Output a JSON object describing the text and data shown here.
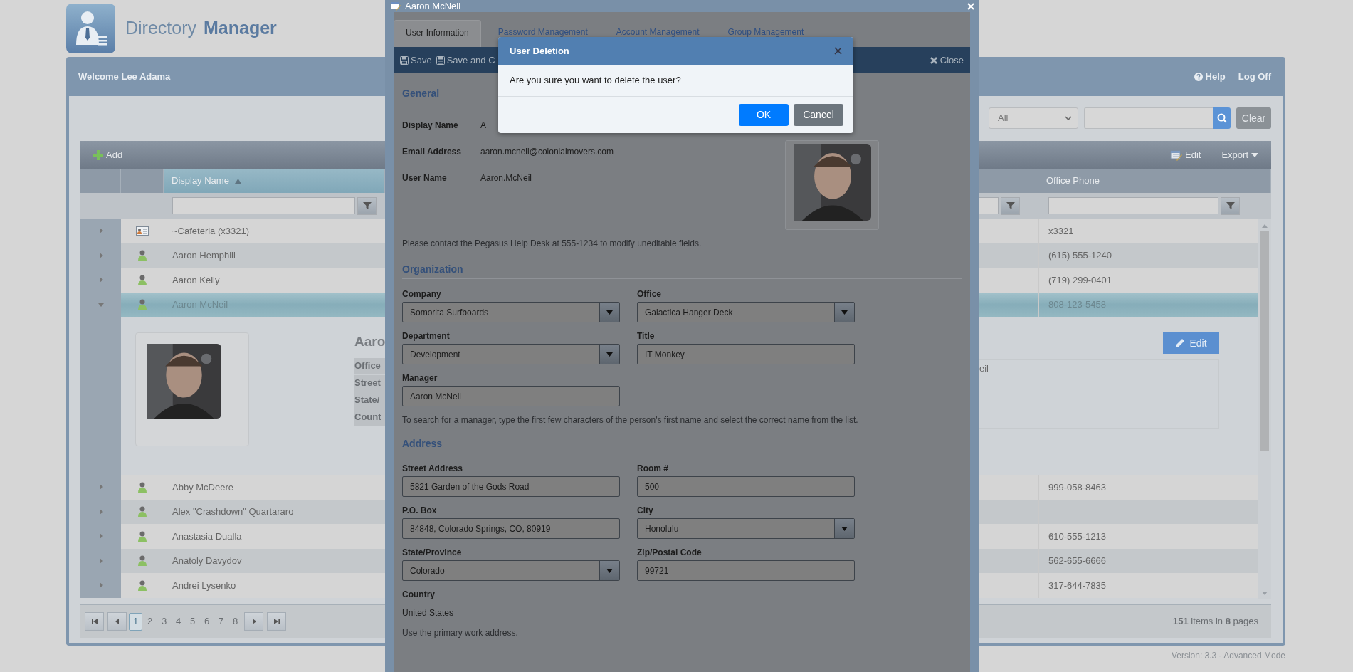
{
  "app": {
    "title_light": "Directory",
    "title_bold": "Manager",
    "welcome": "Welcome Lee Adama",
    "links": [
      {
        "label": "Help",
        "kind": "help"
      },
      {
        "label": "Log Off",
        "kind": "plain"
      }
    ],
    "version": "Version: 3.3 - Advanced Mode"
  },
  "search": {
    "scope": "All",
    "clear": "Clear"
  },
  "grid": {
    "toolbar": {
      "add": "Add",
      "edit": "Edit",
      "export": "Export"
    },
    "columns": [
      {
        "label": "Display Name",
        "sorted": true
      },
      {
        "label": "Office Phone",
        "sorted": false
      }
    ],
    "rows": [
      {
        "kind": "location",
        "name": "~Cafeteria (x3321)",
        "phone": "x3321",
        "expanded": false,
        "selected": false
      },
      {
        "kind": "person",
        "name": "Aaron Hemphill",
        "phone": "(615) 555-1240",
        "expanded": false,
        "selected": false
      },
      {
        "kind": "person",
        "name": "Aaron Kelly",
        "phone": "(719) 299-0401",
        "expanded": false,
        "selected": false
      },
      {
        "kind": "person",
        "name": "Aaron McNeil",
        "phone": "808-123-5458",
        "expanded": true,
        "selected": true
      },
      {
        "kind": "person",
        "name": "Abby McDeere",
        "phone": "999-058-8463",
        "expanded": false,
        "selected": false
      },
      {
        "kind": "person",
        "name": "Alex \"Crashdown\" Quartararo",
        "expanded": false,
        "selected": false
      },
      {
        "kind": "person",
        "name": "Anastasia Dualla",
        "phone": "610-555-1213",
        "expanded": false,
        "selected": false
      },
      {
        "kind": "person",
        "name": "Anatoly Davydov",
        "phone": "562-655-6666",
        "expanded": false,
        "selected": false
      },
      {
        "kind": "person",
        "name": "Andrei Lysenko",
        "phone": "317-644-7835",
        "expanded": false,
        "selected": false
      }
    ],
    "detail": {
      "heading": "Aaro",
      "labels": [
        "Office",
        "Street",
        "State/",
        "Count"
      ],
      "value_fragment": "eil",
      "edit": "Edit"
    },
    "pager": {
      "pages": [
        {
          "label": "1",
          "selected": true
        },
        {
          "label": "2",
          "selected": false
        },
        {
          "label": "3",
          "selected": false
        },
        {
          "label": "4",
          "selected": false
        },
        {
          "label": "5",
          "selected": false
        },
        {
          "label": "6",
          "selected": false
        },
        {
          "label": "7",
          "selected": false
        },
        {
          "label": "8",
          "selected": false
        }
      ],
      "summary": "**151** items in **8** pages"
    }
  },
  "edit_window": {
    "title": "Aaron McNeil",
    "tabs": [
      {
        "label": "User Information",
        "selected": true
      },
      {
        "label": "Password Management",
        "selected": false
      },
      {
        "label": "Account Management",
        "selected": false
      },
      {
        "label": "Group Management",
        "selected": false
      }
    ],
    "toolbar": {
      "save": "Save",
      "save_close": "Save and C",
      "close": "Close"
    },
    "general": {
      "heading": "General",
      "info": [
        {
          "label": "Display Name",
          "value": "A"
        },
        {
          "label": "Email Address",
          "value": "aaron.mcneil@colonialmovers.com"
        },
        {
          "label": "User Name",
          "value": "Aaron.McNeil"
        }
      ],
      "note": "Please contact the Pegasus Help Desk at 555-1234 to modify uneditable fields."
    },
    "organization": {
      "heading": "Organization",
      "fields": [
        {
          "kind": "select",
          "label": "Company",
          "value": "Somorita Surfboards"
        },
        {
          "kind": "select",
          "label": "Office",
          "value": "Galactica Hanger Deck"
        },
        {
          "kind": "select",
          "label": "Department",
          "value": "Development"
        },
        {
          "kind": "text",
          "label": "Title",
          "value": "IT Monkey"
        },
        {
          "kind": "text",
          "label": "Manager",
          "value": "Aaron McNeil"
        }
      ],
      "note": "To search for a manager, type the first few characters of the person's first name and select the correct name from the list."
    },
    "address": {
      "heading": "Address",
      "fields": [
        {
          "kind": "text",
          "label": "Street Address",
          "value": "5821 Garden of the Gods Road"
        },
        {
          "kind": "text",
          "label": "Room #",
          "value": "500"
        },
        {
          "kind": "text",
          "label": "P.O. Box",
          "value": "84848, Colorado Springs, CO, 80919"
        },
        {
          "kind": "select",
          "label": "City",
          "value": "Honolulu"
        },
        {
          "kind": "select",
          "label": "State/Province",
          "value": "Colorado"
        },
        {
          "kind": "text",
          "label": "Zip/Postal Code",
          "value": "99721"
        },
        {
          "kind": "static",
          "label": "Country",
          "value": "United States"
        }
      ],
      "note": "Use the primary work address."
    }
  },
  "dialog": {
    "title": "User Deletion",
    "message": "Are you sure you want to delete the user?",
    "buttons": [
      {
        "label": "OK",
        "kind": "primary"
      },
      {
        "label": "Cancel",
        "kind": "secondary"
      }
    ]
  }
}
